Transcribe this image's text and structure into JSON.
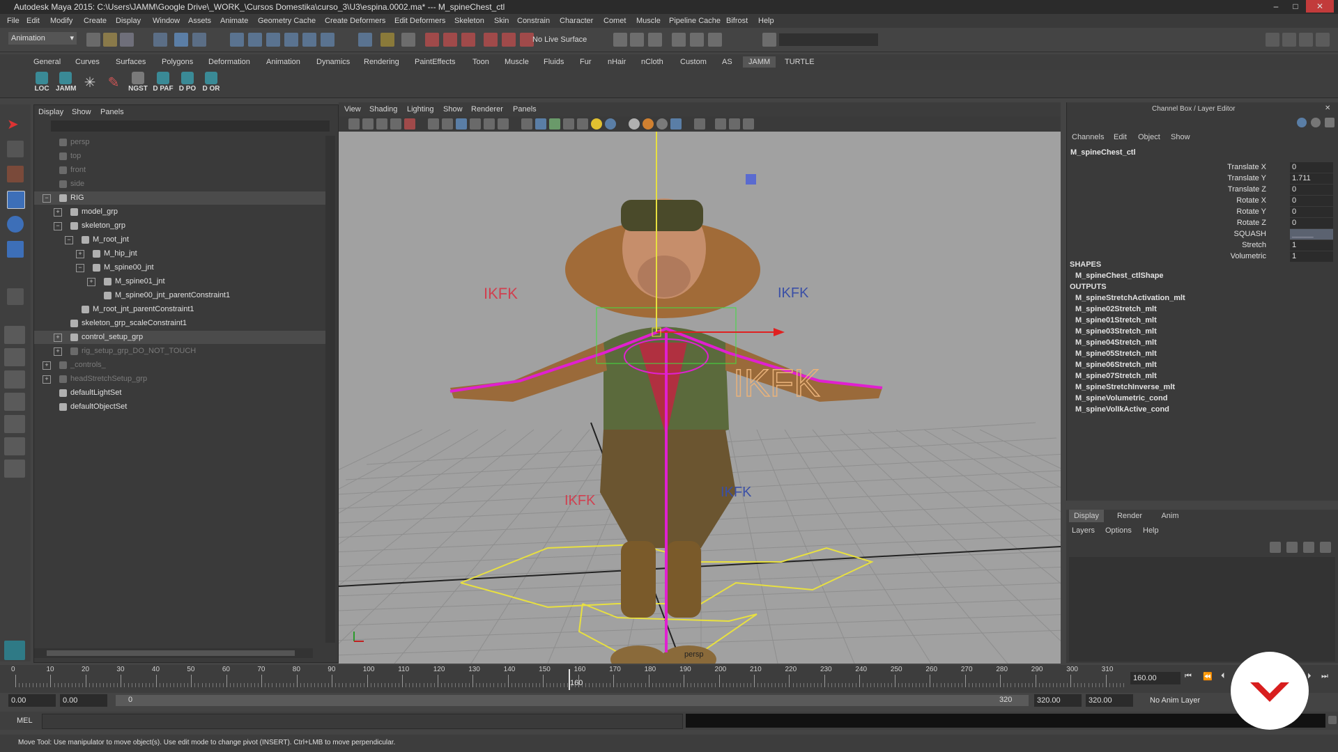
{
  "title_bar": {
    "title": "Autodesk Maya 2015: C:\\Users\\JAMM\\Google Drive\\_WORK_\\Cursos Domestika\\curso_3\\U3\\espina.0002.ma*   ---   M_spineChest_ctl"
  },
  "menus": [
    "File",
    "Edit",
    "Modify",
    "Create",
    "Display",
    "Window",
    "Assets",
    "Animate",
    "Geometry Cache",
    "Create Deformers",
    "Edit Deformers",
    "Skeleton",
    "Skin",
    "Constrain",
    "Character",
    "Comet",
    "Muscle",
    "Pipeline Cache",
    "Bifrost",
    "Help"
  ],
  "status_line": {
    "menu_set": "Animation",
    "live_surface": "No Live Surface"
  },
  "shelf_tabs": [
    "General",
    "Curves",
    "Surfaces",
    "Polygons",
    "Deformation",
    "Animation",
    "Dynamics",
    "Rendering",
    "PaintEffects",
    "Toon",
    "Muscle",
    "Fluids",
    "Fur",
    "nHair",
    "nCloth",
    "Custom",
    "AS",
    "JAMM",
    "TURTLE"
  ],
  "shelf_buttons": [
    "LOC",
    "JAMM",
    "",
    "",
    "NGST",
    "D PAF",
    "D PO",
    "D OR"
  ],
  "outliner": {
    "menu": [
      "Display",
      "Show",
      "Panels"
    ],
    "items": [
      {
        "label": "persp",
        "indent": 0,
        "dim": true
      },
      {
        "label": "top",
        "indent": 0,
        "dim": true
      },
      {
        "label": "front",
        "indent": 0,
        "dim": true
      },
      {
        "label": "side",
        "indent": 0,
        "dim": true
      },
      {
        "label": "RIG",
        "indent": 0,
        "dim": false
      },
      {
        "label": "model_grp",
        "indent": 1,
        "dim": false
      },
      {
        "label": "skeleton_grp",
        "indent": 1,
        "dim": false
      },
      {
        "label": "M_root_jnt",
        "indent": 2,
        "dim": false
      },
      {
        "label": "M_hip_jnt",
        "indent": 3,
        "dim": false
      },
      {
        "label": "M_spine00_jnt",
        "indent": 3,
        "dim": false
      },
      {
        "label": "M_spine01_jnt",
        "indent": 4,
        "dim": false
      },
      {
        "label": "M_spine00_jnt_parentConstraint1",
        "indent": 4,
        "dim": false
      },
      {
        "label": "M_root_jnt_parentConstraint1",
        "indent": 2,
        "dim": false
      },
      {
        "label": "skeleton_grp_scaleConstraint1",
        "indent": 1,
        "dim": false
      },
      {
        "label": "control_setup_grp",
        "indent": 1,
        "dim": false
      },
      {
        "label": "rig_setup_grp_DO_NOT_TOUCH",
        "indent": 1,
        "dim": true
      },
      {
        "label": "_controls_",
        "indent": 0,
        "dim": true
      },
      {
        "label": "headStretchSetup_grp",
        "indent": 0,
        "dim": true
      },
      {
        "label": "defaultLightSet",
        "indent": 0,
        "dim": false
      },
      {
        "label": "defaultObjectSet",
        "indent": 0,
        "dim": false
      }
    ]
  },
  "viewport": {
    "menu": [
      "View",
      "Shading",
      "Lighting",
      "Show",
      "Renderer",
      "Panels"
    ],
    "camera_label": "persp",
    "ikfk_labels": [
      "IKFK",
      "IKFK",
      "IKFK",
      "IKFK",
      "IKFK"
    ]
  },
  "channel_box": {
    "header": "Channel Box / Layer Editor",
    "menu": [
      "Channels",
      "Edit",
      "Object",
      "Show"
    ],
    "object": "M_spineChest_ctl",
    "attrs": [
      {
        "name": "Translate X",
        "value": "0"
      },
      {
        "name": "Translate Y",
        "value": "1.711"
      },
      {
        "name": "Translate Z",
        "value": "0"
      },
      {
        "name": "Rotate X",
        "value": "0"
      },
      {
        "name": "Rotate Y",
        "value": "0"
      },
      {
        "name": "Rotate Z",
        "value": "0"
      },
      {
        "name": "SQUASH",
        "value": "_____"
      },
      {
        "name": "Stretch",
        "value": "1"
      },
      {
        "name": "Volumetric",
        "value": "1"
      }
    ],
    "shapes_label": "SHAPES",
    "shapes": [
      "M_spineChest_ctlShape"
    ],
    "outputs_label": "OUTPUTS",
    "outputs": [
      "M_spineStretchActivation_mlt",
      "M_spine02Stretch_mlt",
      "M_spine01Stretch_mlt",
      "M_spine03Stretch_mlt",
      "M_spine04Stretch_mlt",
      "M_spine05Stretch_mlt",
      "M_spine06Stretch_mlt",
      "M_spine07Stretch_mlt",
      "M_spineStretchInverse_mlt",
      "M_spineVolumetric_cond",
      "M_spineVolIkActive_cond"
    ]
  },
  "layer_editor": {
    "tabs": [
      "Display",
      "Render",
      "Anim"
    ],
    "menu": [
      "Layers",
      "Options",
      "Help"
    ]
  },
  "time_slider": {
    "ticks": [
      "0",
      "10",
      "20",
      "30",
      "40",
      "50",
      "60",
      "70",
      "80",
      "90",
      "100",
      "110",
      "120",
      "130",
      "140",
      "150",
      "160",
      "170",
      "180",
      "190",
      "200",
      "210",
      "220",
      "230",
      "240",
      "250",
      "260",
      "270",
      "280",
      "290",
      "300",
      "310"
    ],
    "current_frame": "160",
    "current_frame_field": "160.00"
  },
  "range_slider": {
    "start": "0.00",
    "anim_start": "0.00",
    "range_start": "0",
    "range_end": "320",
    "end": "320.00",
    "anim_end": "320.00",
    "anim_layer": "No Anim Layer"
  },
  "command_line": {
    "label": "MEL"
  },
  "help_line": {
    "text": "Move Tool: Use manipulator to move object(s). Use edit mode to change pivot (INSERT).  Ctrl+LMB to move perpendicular."
  },
  "colors": {
    "accent": "#5a7ea6",
    "ikfk_red": "#d04050",
    "ikfk_blue": "#3a4fa6",
    "control_magenta": "#e020d0",
    "logo_red": "#d81e1e"
  }
}
